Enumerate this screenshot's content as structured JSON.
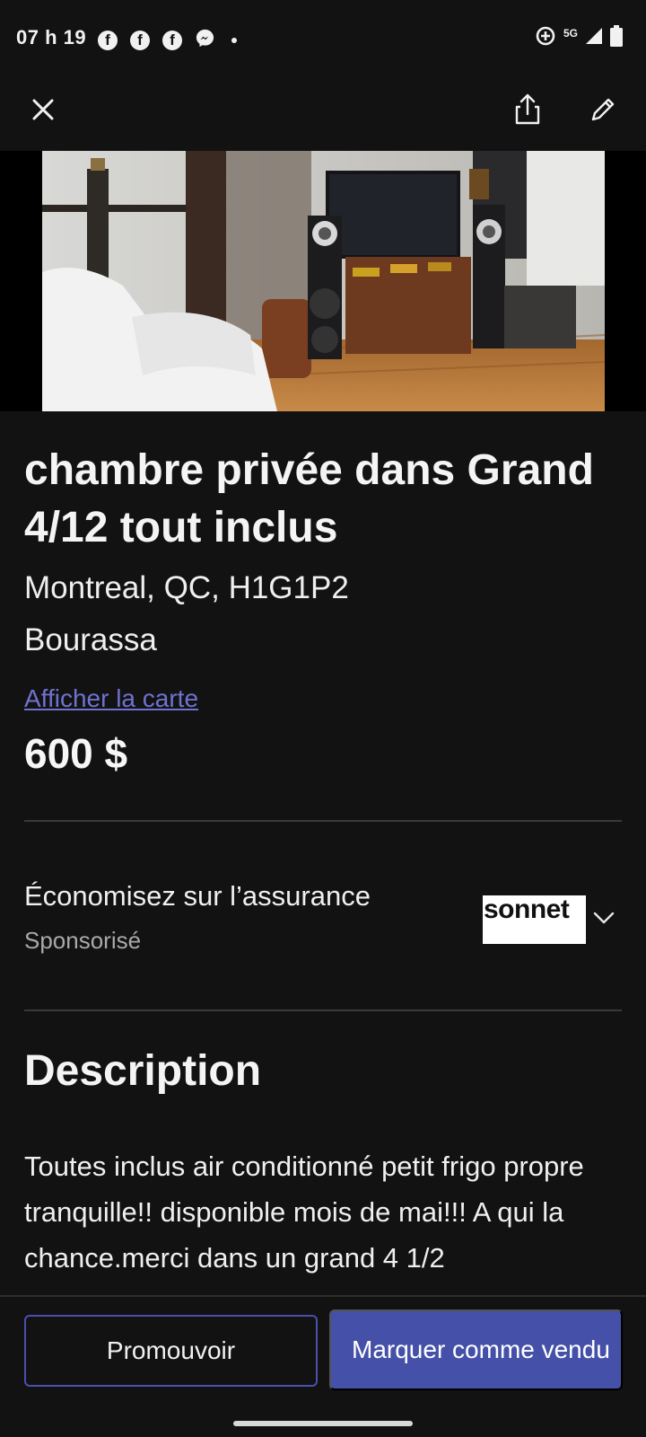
{
  "status_bar": {
    "time": "07 h 19",
    "notifications": [
      "facebook-icon",
      "facebook-icon",
      "facebook-icon",
      "messenger-icon",
      "dot"
    ],
    "network": "5G"
  },
  "listing": {
    "title": "chambre privée dans Grand 4/12 tout inclus",
    "location": "Montreal, QC, H1G1P2",
    "neighborhood": "Bourassa",
    "map_link": "Afficher la carte",
    "price": "600 $"
  },
  "insurance": {
    "title": "Économisez sur l’assurance",
    "subtitle": "Sponsorisé",
    "sponsor": "sonnet"
  },
  "description": {
    "heading": "Description",
    "text": "Toutes inclus air conditionné petit frigo propre tranquille!! disponible mois de mai!!! A qui la chance.merci dans un grand 4 1/2"
  },
  "actions": {
    "promote": "Promouvoir",
    "mark_sold": "Marquer comme vendu"
  },
  "colors": {
    "background": "#121212",
    "accent": "#4551a8",
    "link": "#6f72cf"
  }
}
